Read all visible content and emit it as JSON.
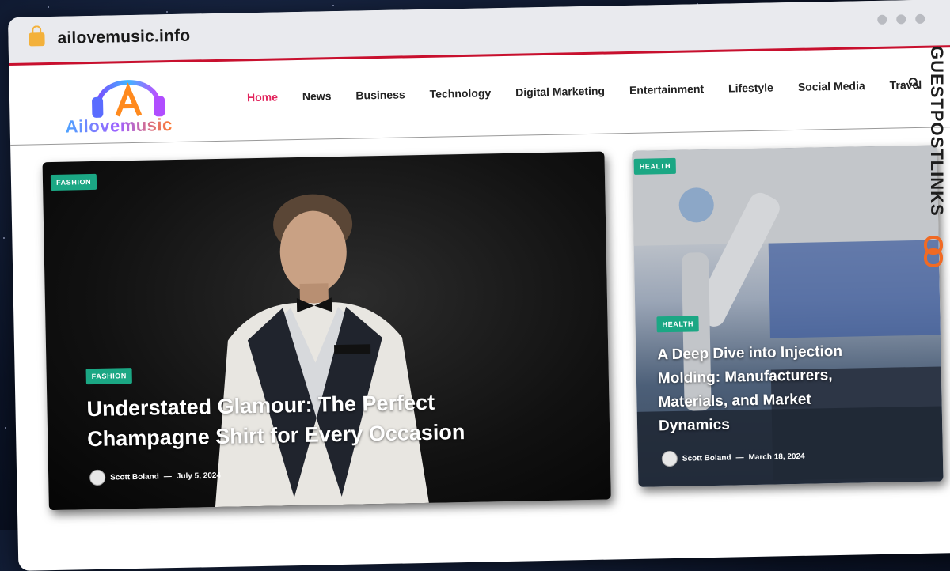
{
  "browser": {
    "url": "ailovemusic.info"
  },
  "site": {
    "logo_text": "Ailovemusic",
    "nav": [
      {
        "label": "Home",
        "active": true
      },
      {
        "label": "News"
      },
      {
        "label": "Business"
      },
      {
        "label": "Technology"
      },
      {
        "label": "Digital Marketing"
      },
      {
        "label": "Entertainment"
      },
      {
        "label": "Lifestyle"
      },
      {
        "label": "Social Media"
      },
      {
        "label": "Travel"
      }
    ]
  },
  "hero": {
    "corner_tag": "FASHION",
    "tag": "FASHION",
    "title_line1": "Understated Glamour: The Perfect",
    "title_line2": "Champagne Shirt for Every Occasion",
    "author": "Scott Boland",
    "separator": "—",
    "date": "July 5, 2024"
  },
  "side_post": {
    "corner_tag": "HEALTH",
    "tag": "HEALTH",
    "title_lines": [
      "A Deep Dive into Injection",
      "Molding: Manufacturers,",
      "Materials, and Market",
      "Dynamics"
    ],
    "author": "Scott Boland",
    "separator": "—",
    "date": "March 18, 2024"
  },
  "watermark": {
    "text": "GUESTPOSTLINKS"
  },
  "colors": {
    "accent": "#e2245c",
    "tag_green": "#1ba784",
    "chrome_red": "#c8102e"
  }
}
